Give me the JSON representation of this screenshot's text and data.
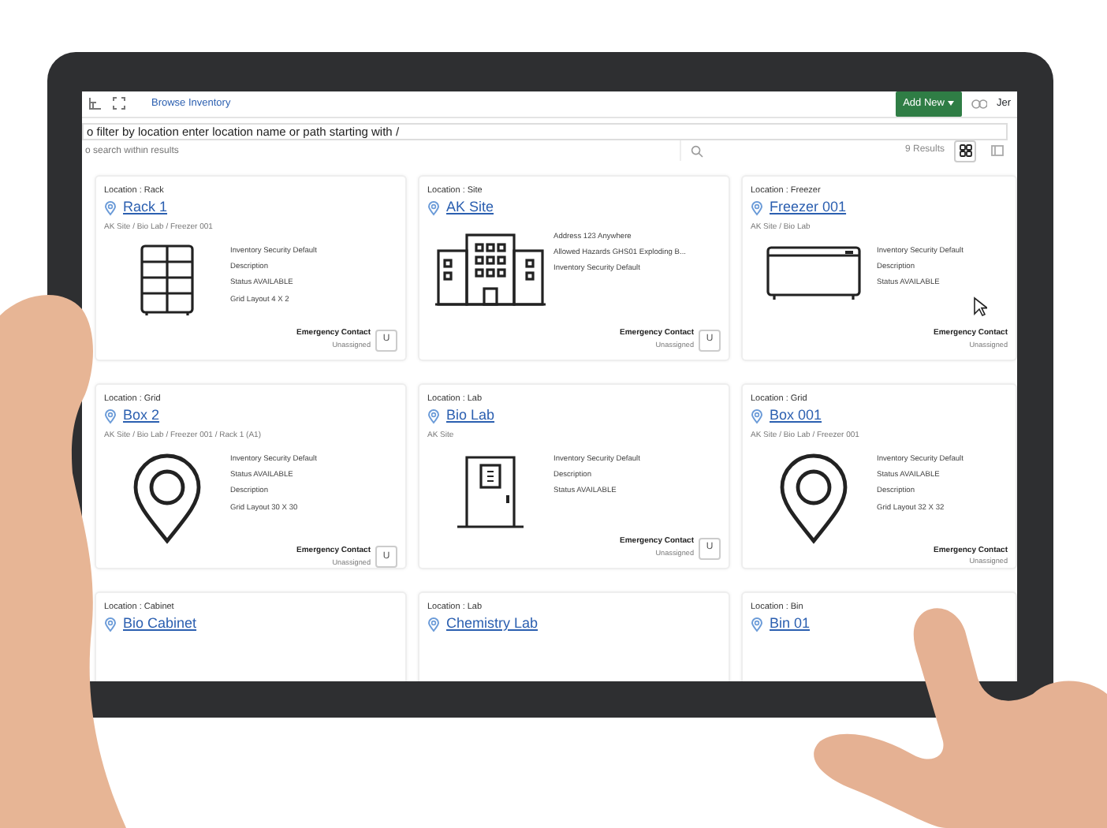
{
  "header": {
    "breadcrumb": "Browse Inventory",
    "add_button": "Add New",
    "user": "Jer"
  },
  "filter": {
    "value": "o filter by location enter location name or path starting with /"
  },
  "search": {
    "placeholder": "o search within results",
    "results": "9 Results",
    "views": [
      {
        "kind": "grid",
        "selected": true
      },
      {
        "kind": "list",
        "selected": false
      }
    ]
  },
  "cards": [
    {
      "kind": "rack",
      "type": "Location : Rack",
      "name": "Rack 1",
      "path": "AK Site / Bio Lab / Freezer 001",
      "details": [
        "Inventory Security  Default",
        "Description",
        "Status  AVAILABLE",
        "Grid Layout  4 X 2"
      ],
      "contact_label": "Emergency Contact",
      "contact": "Unassigned",
      "user_button": "U"
    },
    {
      "kind": "building",
      "type": "Location : Site",
      "name": "AK Site",
      "details": [
        "Address  123 Anywhere",
        "Allowed Hazards  GHS01 Exploding B...",
        "Inventory Security  Default"
      ],
      "contact_label": "Emergency Contact",
      "contact": "Unassigned",
      "user_button": "U"
    },
    {
      "kind": "freezer",
      "type": "Location : Freezer",
      "name": "Freezer 001",
      "path": "AK Site / Bio Lab",
      "details": [
        "Inventory Security  Default",
        "Description",
        "Status  AVAILABLE"
      ],
      "contact_label": "Emergency Contact",
      "contact": "Unassigned",
      "cursor": true
    },
    {
      "kind": "pin",
      "type": "Location : Grid",
      "name": "Box 2",
      "path": "AK Site / Bio Lab / Freezer 001 / Rack 1 (A1)",
      "details": [
        "Inventory Security  Default",
        "Status  AVAILABLE",
        "Description",
        "Grid Layout  30 X 30"
      ],
      "contact_label": "Emergency Contact",
      "contact": "Unassigned",
      "user_button": "U"
    },
    {
      "kind": "door",
      "type": "Location : Lab",
      "name": "Bio Lab",
      "path": "AK Site",
      "details": [
        "Inventory Security  Default",
        "Description",
        "Status  AVAILABLE"
      ],
      "contact_label": "Emergency Contact",
      "contact": "Unassigned",
      "user_button": "U"
    },
    {
      "kind": "pin",
      "type": "Location : Grid",
      "name": "Box 001",
      "path": "AK Site / Bio Lab / Freezer 001",
      "details": [
        "Inventory Security  Default",
        "Status  AVAILABLE",
        "Description",
        "Grid Layout  32 X 32"
      ],
      "contact_label": "Emergency Contact",
      "contact": "Unassigned"
    },
    {
      "kind": "none",
      "type": "Location : Cabinet",
      "name": "Bio Cabinet"
    },
    {
      "kind": "none",
      "type": "Location : Lab",
      "name": "Chemistry Lab"
    },
    {
      "kind": "none",
      "type": "Location : Bin",
      "name": "Bin 01"
    }
  ]
}
